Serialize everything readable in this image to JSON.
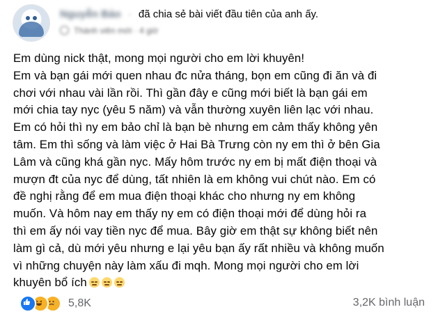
{
  "header": {
    "author_name": "Nguyễn Bảo",
    "action_text": "đã chia sẻ bài viết đầu tiên của anh ấy.",
    "role": "Thành viên mới",
    "time": "4 giờ"
  },
  "post": {
    "lines": [
      "Em dùng nick thật, mong mọi người cho em lời khuyên!",
      "Em và bạn gái mới quen nhau đc nửa tháng, bọn em cũng đi ăn và đi",
      "chơi với nhau vài lần rồi. Thì gần đây e cũng mới biết là bạn gái em",
      "mới chia tay nyc (yêu 5 năm) và vẫn thường xuyên liên lạc với nhau.",
      "Em có hỏi thì ny em bảo chỉ là bạn bè nhưng em cảm thấy không yên",
      "tâm. Em thì sống và làm việc ở Hai Bà Trưng còn ny em thì ở bên Gia",
      "Lâm và cũng khá gần nyc. Mấy hôm trước ny em bị mất điện thoại và",
      "mượn đt của nyc để dùng, tất nhiên là em không vui chút nào. Em có",
      "đề nghị rằng để em mua điện thoại khác cho nhưng ny em không",
      "muốn. Và hôm nay em thấy ny em có điện thoại mới để dùng hỏi ra",
      "thì em ấy nói vay tiền nyc để mua. Bây giờ em thật sự không biết nên",
      "làm gì cả, dù mới yêu nhưng e lại yêu bạn ấy rất nhiều và không muốn",
      "vì những chuyện này làm xấu đi mqh. Mong mọi người cho em lời",
      "khuyên bổ ích"
    ],
    "trailing_emojis": [
      "pensive-face",
      "pensive-face",
      "pensive-face"
    ]
  },
  "footer": {
    "reactions": [
      "like",
      "haha",
      "sad"
    ],
    "reaction_count": "5,8K",
    "comment_count": "3,2K bình luận"
  },
  "colors": {
    "text": "#050505",
    "muted": "#65676b",
    "like_blue": "#1877f2",
    "emoji_yellow": "#f7b125"
  }
}
